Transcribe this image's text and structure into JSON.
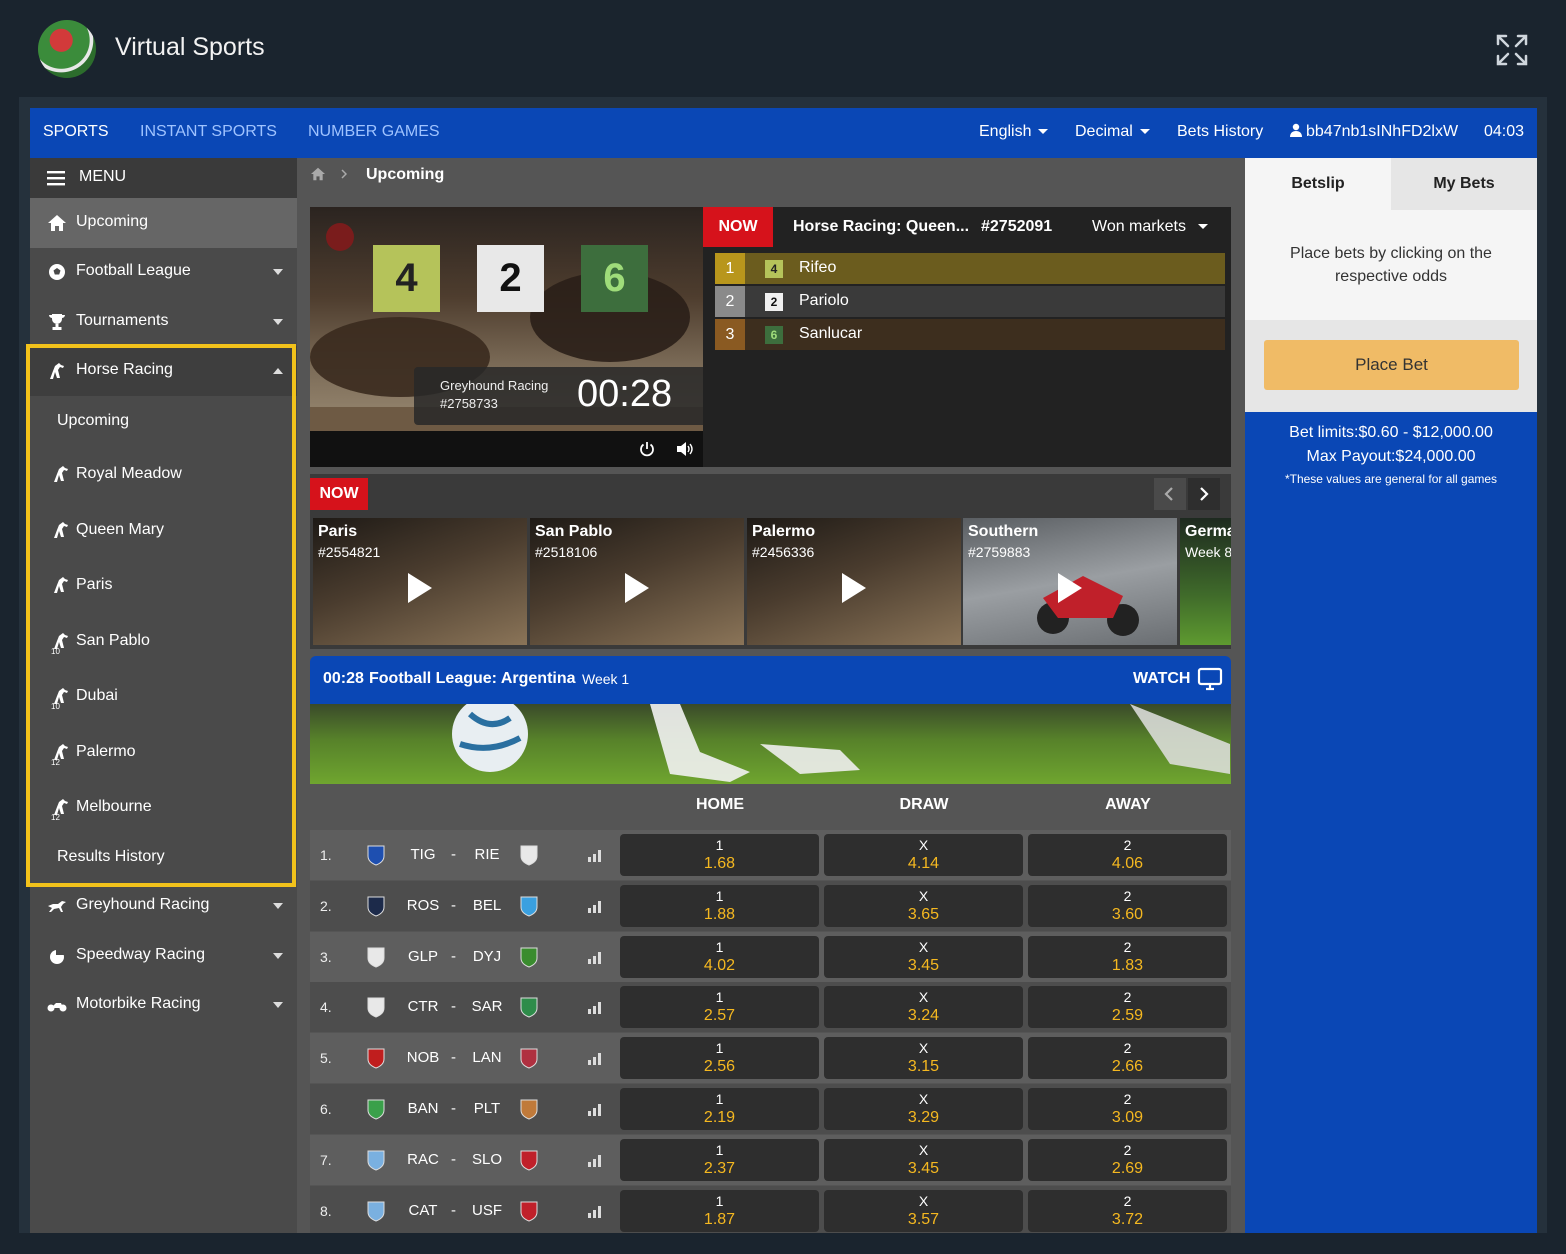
{
  "app": {
    "title": "Virtual Sports"
  },
  "topnav": {
    "tabs": [
      {
        "label": "SPORTS",
        "active": true
      },
      {
        "label": "INSTANT SPORTS",
        "active": false
      },
      {
        "label": "NUMBER GAMES",
        "active": false
      }
    ],
    "language": "English",
    "odds_format": "Decimal",
    "bets_history": "Bets History",
    "user": "bb47nb1sINhFD2lxW",
    "clock": "04:03"
  },
  "sidebar": {
    "menu_label": "MENU",
    "items": [
      {
        "label": "Upcoming",
        "icon": "home-icon"
      },
      {
        "label": "Football League",
        "icon": "soccer-ball-icon"
      },
      {
        "label": "Tournaments",
        "icon": "trophy-icon"
      },
      {
        "label": "Horse Racing",
        "icon": "horse-icon",
        "expanded": true
      },
      {
        "label": "Greyhound Racing",
        "icon": "greyhound-icon"
      },
      {
        "label": "Speedway Racing",
        "icon": "speedway-icon"
      },
      {
        "label": "Motorbike Racing",
        "icon": "motorbike-icon"
      }
    ],
    "horse_sub": [
      {
        "label": "Upcoming"
      },
      {
        "label": "Royal Meadow"
      },
      {
        "label": "Queen Mary"
      },
      {
        "label": "Paris"
      },
      {
        "label": "San Pablo",
        "badge": "10"
      },
      {
        "label": "Dubai",
        "badge": "10"
      },
      {
        "label": "Palermo",
        "badge": "12"
      },
      {
        "label": "Melbourne",
        "badge": "12"
      },
      {
        "label": "Results History"
      }
    ]
  },
  "breadcrumb": {
    "current": "Upcoming"
  },
  "video": {
    "tiles": [
      "4",
      "2",
      "6"
    ],
    "next_event": "Greyhound Racing",
    "next_event_id": "#2758733",
    "countdown": "00:28"
  },
  "now_panel": {
    "badge": "NOW",
    "title": "Horse Racing: Queen...",
    "event_id": "#2752091",
    "markets": "Won markets",
    "results": [
      {
        "pos": "1",
        "num": "4",
        "name": "Rifeo"
      },
      {
        "pos": "2",
        "num": "2",
        "name": "Pariolo"
      },
      {
        "pos": "3",
        "num": "6",
        "name": "Sanlucar"
      }
    ]
  },
  "strip": {
    "badge": "NOW",
    "thumbs": [
      {
        "title": "Paris",
        "sub": "#2554821"
      },
      {
        "title": "San Pablo",
        "sub": "#2518106"
      },
      {
        "title": "Palermo",
        "sub": "#2456336"
      },
      {
        "title": "Southern",
        "sub": "#2759883"
      },
      {
        "title": "Germa",
        "sub": "Week 8"
      }
    ]
  },
  "event": {
    "time": "00:28",
    "title": "Football League: Argentina",
    "week": "Week 1",
    "watch": "WATCH"
  },
  "odds_table": {
    "headers": [
      "HOME",
      "DRAW",
      "AWAY"
    ],
    "rows": [
      {
        "idx": "1.",
        "home": "TIG",
        "away": "RIE",
        "odds": [
          [
            "1",
            "1.68"
          ],
          [
            "X",
            "4.14"
          ],
          [
            "2",
            "4.06"
          ]
        ]
      },
      {
        "idx": "2.",
        "home": "ROS",
        "away": "BEL",
        "odds": [
          [
            "1",
            "1.88"
          ],
          [
            "X",
            "3.65"
          ],
          [
            "2",
            "3.60"
          ]
        ]
      },
      {
        "idx": "3.",
        "home": "GLP",
        "away": "DYJ",
        "odds": [
          [
            "1",
            "4.02"
          ],
          [
            "X",
            "3.45"
          ],
          [
            "2",
            "1.83"
          ]
        ]
      },
      {
        "idx": "4.",
        "home": "CTR",
        "away": "SAR",
        "odds": [
          [
            "1",
            "2.57"
          ],
          [
            "X",
            "3.24"
          ],
          [
            "2",
            "2.59"
          ]
        ]
      },
      {
        "idx": "5.",
        "home": "NOB",
        "away": "LAN",
        "odds": [
          [
            "1",
            "2.56"
          ],
          [
            "X",
            "3.15"
          ],
          [
            "2",
            "2.66"
          ]
        ]
      },
      {
        "idx": "6.",
        "home": "BAN",
        "away": "PLT",
        "odds": [
          [
            "1",
            "2.19"
          ],
          [
            "X",
            "3.29"
          ],
          [
            "2",
            "3.09"
          ]
        ]
      },
      {
        "idx": "7.",
        "home": "RAC",
        "away": "SLO",
        "odds": [
          [
            "1",
            "2.37"
          ],
          [
            "X",
            "3.45"
          ],
          [
            "2",
            "2.69"
          ]
        ]
      },
      {
        "idx": "8.",
        "home": "CAT",
        "away": "USF",
        "odds": [
          [
            "1",
            "1.87"
          ],
          [
            "X",
            "3.57"
          ],
          [
            "2",
            "3.72"
          ]
        ]
      }
    ]
  },
  "betslip": {
    "tabs": [
      "Betslip",
      "My Bets"
    ],
    "hint": "Place bets by clicking on the respective odds",
    "place_bet": "Place Bet",
    "limits": "Bet limits:$0.60 - $12,000.00",
    "max_payout": "Max Payout:$24,000.00",
    "note": "*These values are general for all games"
  },
  "colors": {
    "nav_blue": "#0a47b5",
    "odds_gold": "#f5b820",
    "now_red": "#d6121b",
    "highlight": "#f2c21b"
  }
}
